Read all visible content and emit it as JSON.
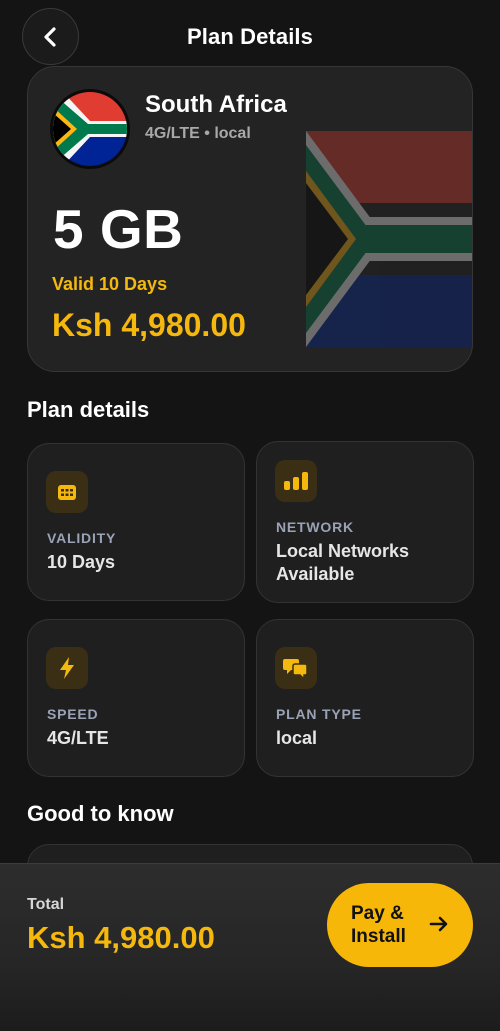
{
  "header": {
    "title": "Plan Details",
    "back_icon": "chevron-left-icon"
  },
  "plan": {
    "country": "South Africa",
    "network_line": "4G/LTE • local",
    "data_amount": "5 GB",
    "validity_text": "Valid 10 Days",
    "price": "Ksh 4,980.00",
    "flag_icon": "south-africa-flag-icon"
  },
  "details": {
    "title": "Plan details",
    "tiles": [
      {
        "label": "VALIDITY",
        "value": "10 Days",
        "icon": "calendar-icon"
      },
      {
        "label": "NETWORK",
        "value": "Local Networks Available",
        "icon": "signal-bars-icon"
      },
      {
        "label": "SPEED",
        "value": "4G/LTE",
        "icon": "lightning-icon"
      },
      {
        "label": "PLAN TYPE",
        "value": "local",
        "icon": "chat-bubbles-icon"
      }
    ]
  },
  "good_to_know": {
    "title": "Good to know"
  },
  "footer": {
    "total_label": "Total",
    "total_value": "Ksh 4,980.00",
    "pay_button": "Pay & Install",
    "arrow_icon": "arrow-right-icon"
  },
  "colors": {
    "accent": "#f5b80f",
    "background": "#141414",
    "card": "#232323"
  }
}
